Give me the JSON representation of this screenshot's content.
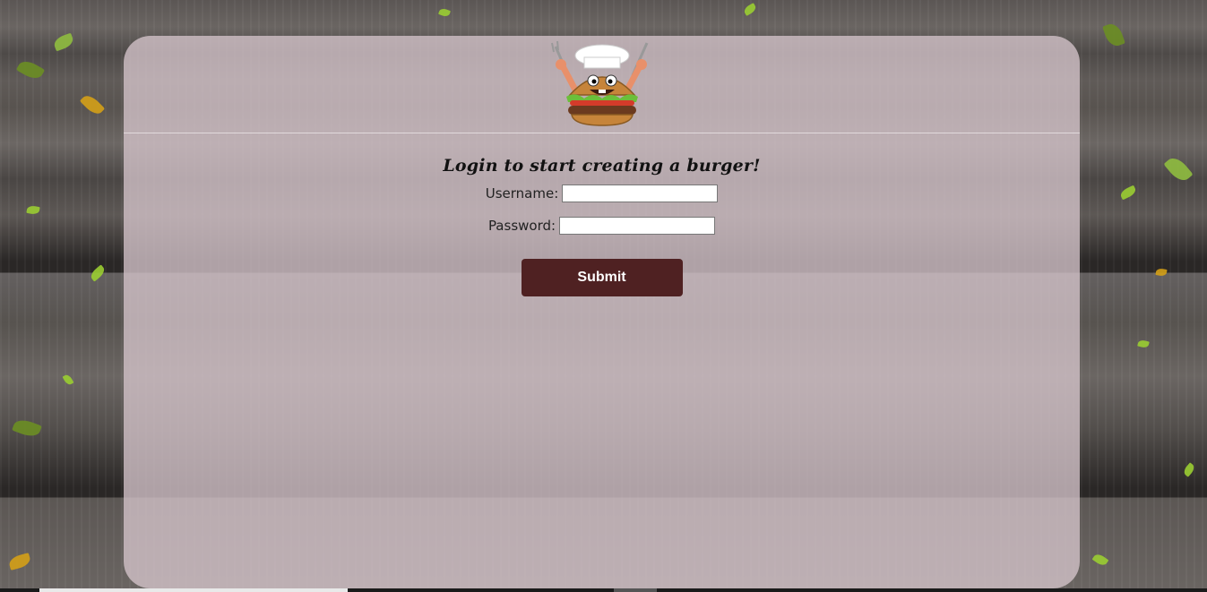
{
  "page": {
    "heading": "Login to start creating a burger!"
  },
  "form": {
    "username_label": "Username:",
    "username_value": "",
    "password_label": "Password:",
    "password_value": "",
    "submit_label": "Submit"
  },
  "logo": {
    "icon": "burger-chef-mascot-icon"
  },
  "colors": {
    "button_bg": "#4f2122",
    "panel_bg": "#d5c4cb",
    "leaf": "#9acd32"
  }
}
